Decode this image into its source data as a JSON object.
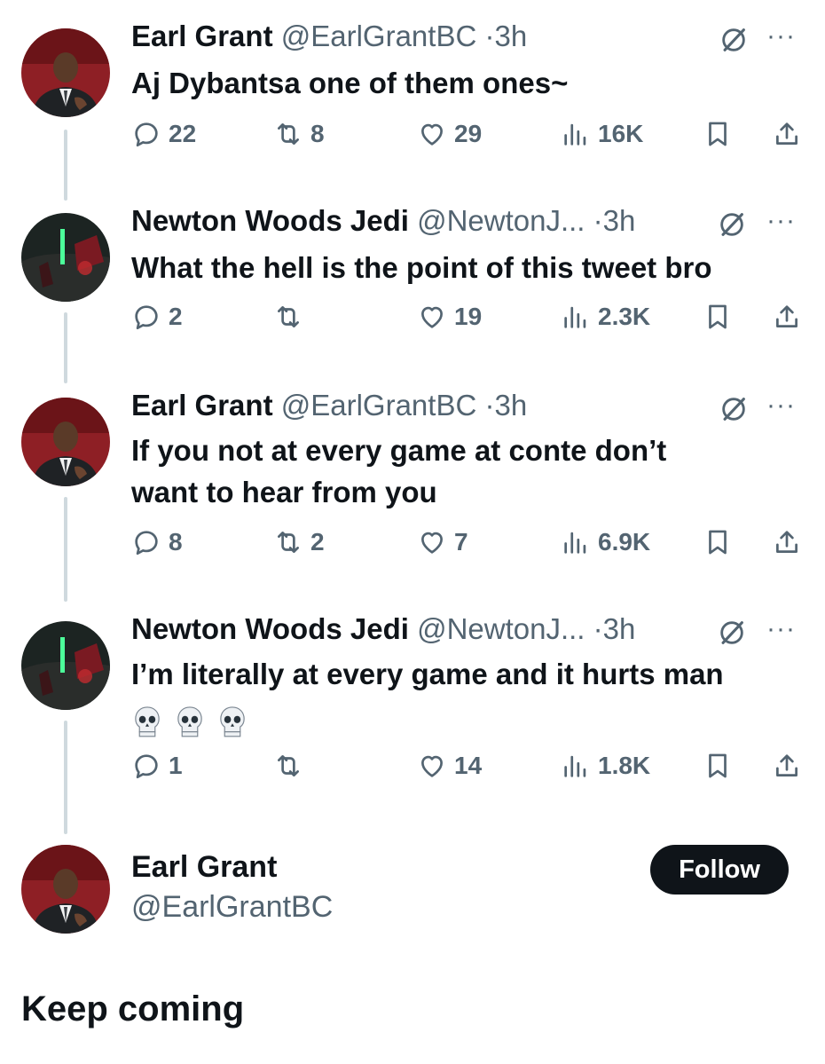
{
  "tweets": [
    {
      "name": "Earl Grant",
      "handle": "@EarlGrantBC",
      "dot": "·",
      "time": "3h",
      "text": "Aj Dybantsa one of them ones~",
      "replies": "22",
      "retweets": "8",
      "likes": "29",
      "views": "16K",
      "avatar": "earl"
    },
    {
      "name": "Newton Woods Jedi",
      "handle": "@NewtonJ...",
      "dot": "·",
      "time": "3h",
      "text": "What the hell is the point of this tweet bro",
      "replies": "2",
      "retweets": "",
      "likes": "19",
      "views": "2.3K",
      "avatar": "newton"
    },
    {
      "name": "Earl Grant",
      "handle": "@EarlGrantBC",
      "dot": "·",
      "time": "3h",
      "text_line1": "If you not at every game at conte don’t",
      "text_line2": "want to hear from you",
      "replies": "8",
      "retweets": "2",
      "likes": "7",
      "views": "6.9K",
      "avatar": "earl"
    },
    {
      "name": "Newton Woods Jedi",
      "handle": "@NewtonJ...",
      "dot": "·",
      "time": "3h",
      "text": "I’m literally at every game and it hurts man",
      "emoji": [
        "skull-emoji",
        "skull-emoji",
        "skull-emoji"
      ],
      "replies": "1",
      "retweets": "",
      "likes": "14",
      "views": "1.8K",
      "avatar": "newton"
    }
  ],
  "main": {
    "name": "Earl Grant",
    "handle": "@EarlGrantBC",
    "follow_label": "Follow",
    "text": "Keep coming"
  },
  "icons": {
    "more": "···",
    "reply": "reply-icon",
    "retweet": "retweet-icon",
    "like": "heart-icon",
    "views": "views-icon",
    "bookmark": "bookmark-icon",
    "share": "share-icon",
    "grok": "grok-icon"
  },
  "colors": {
    "text": "#0f1419",
    "secondary": "#536471",
    "thread_line": "#cfd9de",
    "follow_bg": "#0f1419"
  }
}
